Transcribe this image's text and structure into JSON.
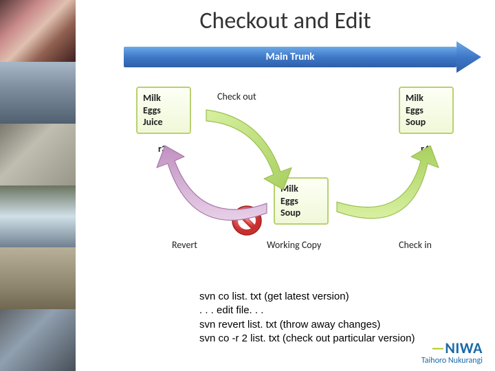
{
  "title": "Checkout and Edit",
  "trunk_label": "Main Trunk",
  "revisions": {
    "r3": {
      "label": "r3",
      "items": [
        "Milk",
        "Eggs",
        "Juice"
      ]
    },
    "r4": {
      "label": "r4",
      "items": [
        "Milk",
        "Eggs",
        "Soup"
      ]
    },
    "working": {
      "label": "Working Copy",
      "items": [
        "Milk",
        "Eggs",
        "Soup"
      ]
    }
  },
  "arrows": {
    "checkout": "Check out",
    "revert": "Revert",
    "checkin": "Check in"
  },
  "commands": [
    "svn co list. txt (get latest version)",
    ". . . edit file. . .",
    "svn revert list. txt (throw away changes)",
    "svn co -r 2 list. txt (check out particular version)"
  ],
  "logo": {
    "name": "NIWA",
    "subtitle": "Taihoro Nukurangi"
  },
  "colors": {
    "trunk": "#3E78C8",
    "box_border": "#b8d070",
    "logo_blue": "#186AA8",
    "logo_green": "#B0C818"
  }
}
